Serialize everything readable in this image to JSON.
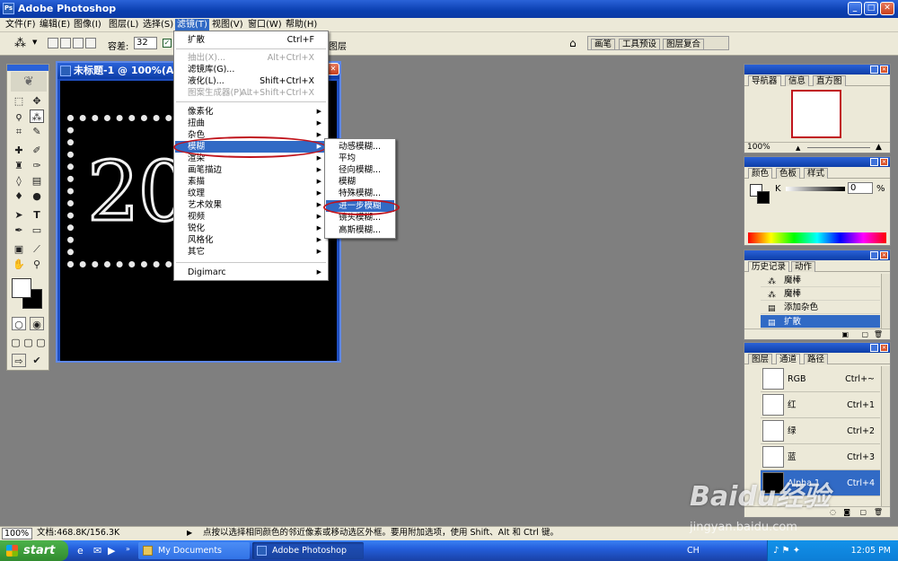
{
  "app": {
    "title": "Adobe Photoshop"
  },
  "menubar": [
    "文件(F)",
    "编辑(E)",
    "图像(I)",
    "图层(L)",
    "选择(S)",
    "滤镜(T)",
    "视图(V)",
    "窗口(W)",
    "帮助(H)"
  ],
  "options": {
    "tolerance_label": "容差:",
    "tolerance_value": "32",
    "layer_label": "图层",
    "tabs": [
      "画笔",
      "工具预设",
      "图层复合"
    ]
  },
  "document": {
    "title": "未标题-1 @ 100%(Alpha 1)",
    "canvas_text": "20"
  },
  "filter_menu": {
    "items": [
      {
        "label": "扩散",
        "shortcut": "Ctrl+F",
        "disabled": false
      },
      {
        "label": "抽出(X)...",
        "shortcut": "Alt+Ctrl+X",
        "disabled": true
      },
      {
        "label": "滤镜库(G)...",
        "shortcut": "",
        "disabled": false
      },
      {
        "label": "液化(L)...",
        "shortcut": "Shift+Ctrl+X",
        "disabled": false
      },
      {
        "label": "图案生成器(P)...",
        "shortcut": "Alt+Shift+Ctrl+X",
        "disabled": true
      },
      {
        "label": "像素化",
        "arrow": true
      },
      {
        "label": "扭曲",
        "arrow": true
      },
      {
        "label": "杂色",
        "arrow": true
      },
      {
        "label": "模糊",
        "arrow": true,
        "highlighted": true
      },
      {
        "label": "渲染",
        "arrow": true
      },
      {
        "label": "画笔描边",
        "arrow": true
      },
      {
        "label": "素描",
        "arrow": true
      },
      {
        "label": "纹理",
        "arrow": true
      },
      {
        "label": "艺术效果",
        "arrow": true
      },
      {
        "label": "视频",
        "arrow": true
      },
      {
        "label": "锐化",
        "arrow": true
      },
      {
        "label": "风格化",
        "arrow": true
      },
      {
        "label": "其它",
        "arrow": true
      },
      {
        "label": "Digimarc",
        "arrow": true
      }
    ]
  },
  "blur_submenu": {
    "items": [
      "动感模糊...",
      "平均",
      "径向模糊...",
      "模糊",
      "特殊模糊...",
      "进一步模糊",
      "镜头模糊...",
      "高斯模糊..."
    ],
    "highlighted": "进一步模糊"
  },
  "navigator": {
    "tabs": [
      "导航器",
      "信息",
      "直方图"
    ],
    "zoom": "100%"
  },
  "color": {
    "tabs": [
      "颜色",
      "色板",
      "样式"
    ],
    "channel_label": "K",
    "value": "0",
    "unit": "%"
  },
  "history": {
    "tabs": [
      "历史记录",
      "动作"
    ],
    "items": [
      {
        "label": "魔棒"
      },
      {
        "label": "魔棒"
      },
      {
        "label": "添加杂色"
      },
      {
        "label": "扩散",
        "selected": true
      }
    ]
  },
  "channels": {
    "tabs": [
      "图层",
      "通道",
      "路径"
    ],
    "items": [
      {
        "name": "RGB",
        "shortcut": "Ctrl+~"
      },
      {
        "name": "红",
        "shortcut": "Ctrl+1"
      },
      {
        "name": "绿",
        "shortcut": "Ctrl+2"
      },
      {
        "name": "蓝",
        "shortcut": "Ctrl+3"
      },
      {
        "name": "Alpha 1",
        "shortcut": "Ctrl+4",
        "selected": true
      }
    ]
  },
  "status": {
    "zoom": "100%",
    "doc": "文档:468.8K/156.3K",
    "hint": "点按以选择相同颜色的邻近像素或移动选区外框。要用附加选项，使用 Shift、Alt 和 Ctrl 键。"
  },
  "taskbar": {
    "start": "start",
    "tasks": [
      "My Documents",
      "Adobe Photoshop"
    ],
    "lang": "CH",
    "time": "12:05 PM"
  },
  "watermark": {
    "brand": "Baidu经验",
    "url": "jingyan.baidu.com"
  },
  "colors": {
    "title_blue": "#0a3fb0",
    "highlight": "#316ac5",
    "ring_red": "#c0141c",
    "workspace": "#7f7f7f"
  }
}
